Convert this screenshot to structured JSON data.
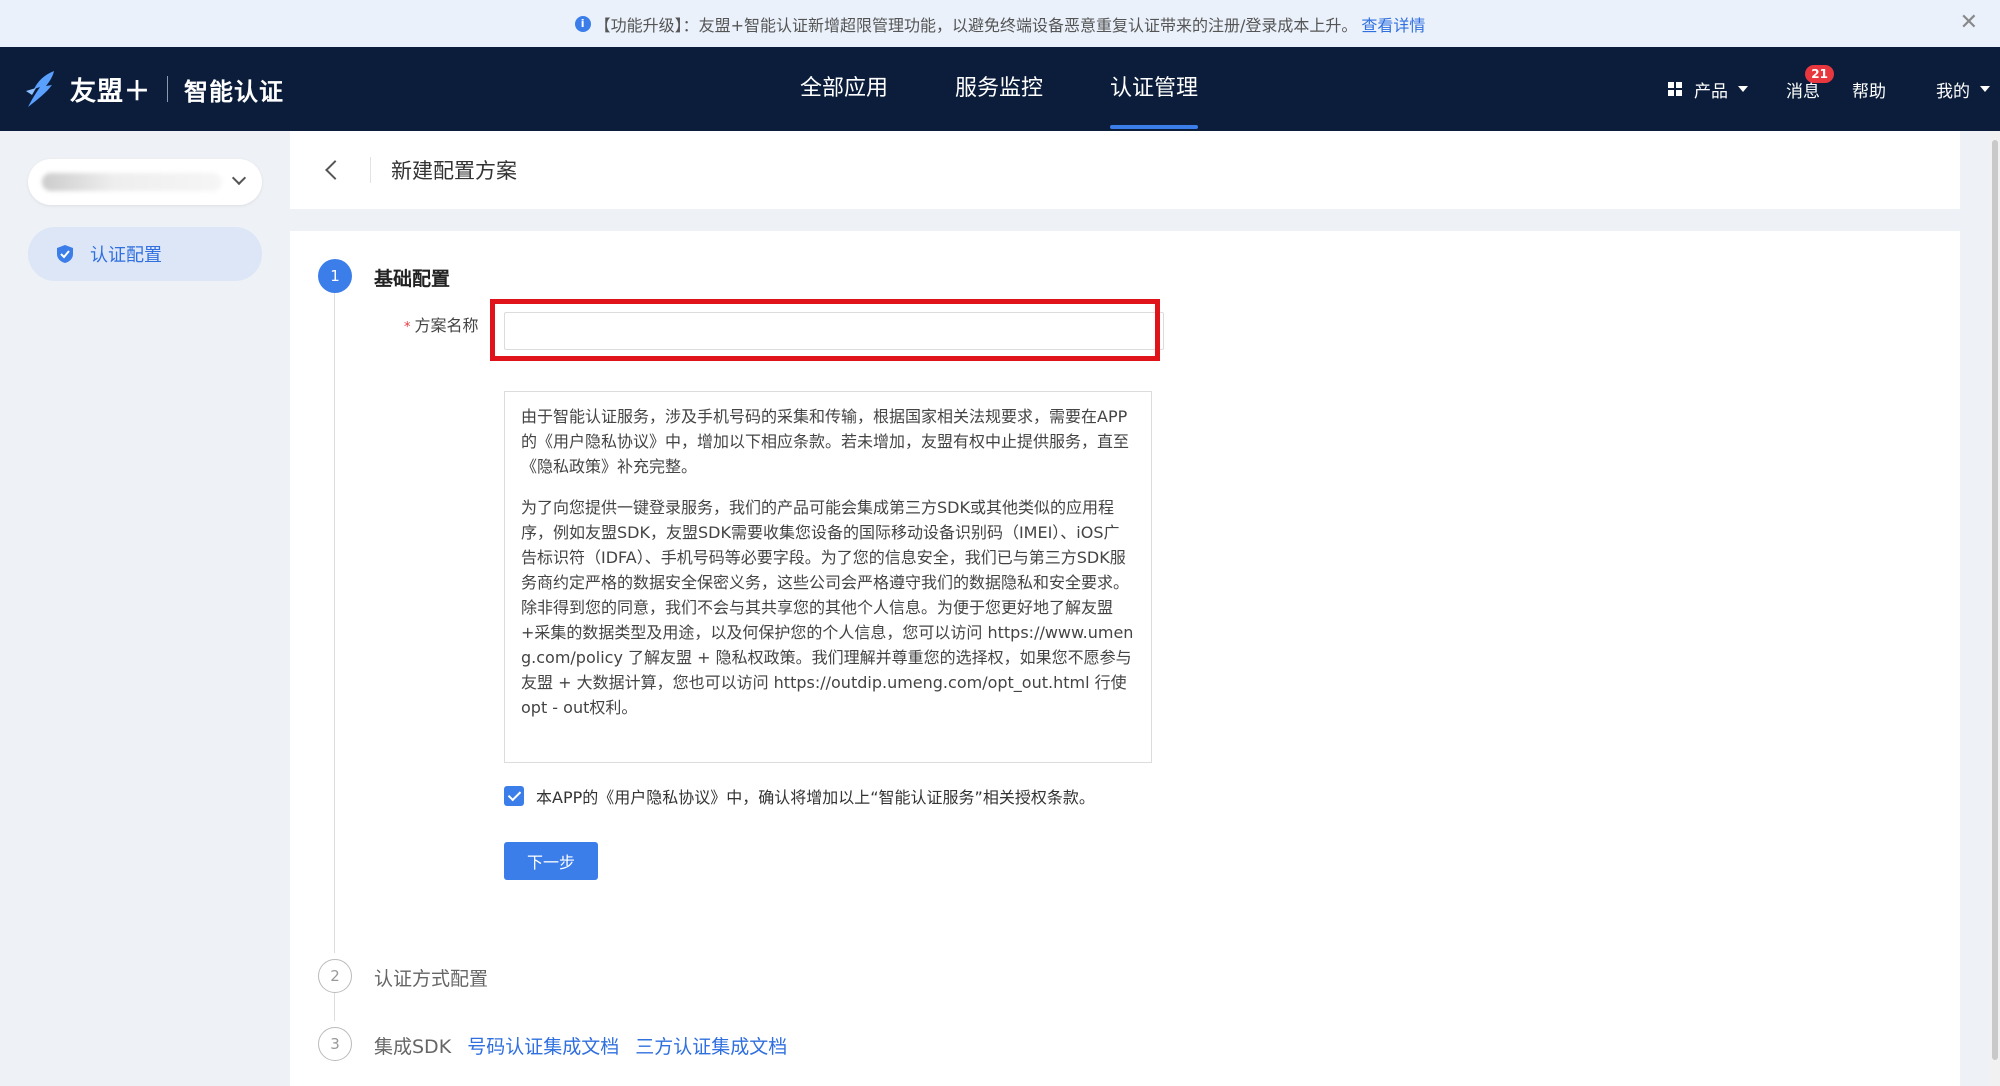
{
  "announcement": {
    "icon": "info-icon",
    "text": "【功能升级】：友盟+智能认证新增超限管理功能，以避免终端设备恶意重复认证带来的注册/登录成本上升。",
    "link": "查看详情",
    "close": "✕"
  },
  "brand": {
    "name": "友盟＋",
    "product": "智能认证"
  },
  "nav": {
    "tabs": [
      {
        "label": "全部应用"
      },
      {
        "label": "服务监控"
      },
      {
        "label": "认证管理"
      }
    ],
    "active_tab": "认证管理",
    "product_label": "产品",
    "messages_label": "消息",
    "messages_count": "21",
    "help_label": "帮助",
    "mine_label": "我的"
  },
  "sidebar": {
    "items": [
      {
        "label": "认证配置",
        "icon": "shield-icon"
      }
    ]
  },
  "header": {
    "title": "新建配置方案"
  },
  "steps": [
    {
      "number": "1",
      "title": "基础配置"
    },
    {
      "number": "2",
      "title": "认证方式配置"
    },
    {
      "number": "3",
      "title": "集成SDK"
    }
  ],
  "form": {
    "required_mark": "*",
    "name_label": "方案名称",
    "name_value": "",
    "agreement_paragraphs": [
      "由于智能认证服务，涉及手机号码的采集和传输，根据国家相关法规要求，需要在APP的《用户隐私协议》中，增加以下相应条款。若未增加，友盟有权中止提供服务，直至《隐私政策》补充完整。",
      "为了向您提供一键登录服务，我们的产品可能会集成第三方SDK或其他类似的应用程序，例如友盟SDK，友盟SDK需要收集您设备的国际移动设备识别码（IMEI）、iOS广告标识符（IDFA）、手机号码等必要字段。为了您的信息安全，我们已与第三方SDK服务商约定严格的数据安全保密义务，这些公司会严格遵守我们的数据隐私和安全要求。除非得到您的同意，我们不会与其共享您的其他个人信息。为便于您更好地了解友盟+采集的数据类型及用途，以及何保护您的个人信息，您可以访问 https://www.umeng.com/policy 了解友盟 + 隐私权政策。我们理解并尊重您的选择权，如果您不愿参与友盟 + 大数据计算，您也可以访问 https://outdip.umeng.com/opt_out.html 行使opt - out权利。"
    ],
    "confirm_checked": true,
    "confirm_text": "本APP的《用户隐私协议》中，确认将增加以上“智能认证服务”相关授权条款。",
    "next_button": "下一步"
  },
  "sdk_links": {
    "phone_doc": "号码认证集成文档",
    "third_party_doc": "三方认证集成文档"
  }
}
